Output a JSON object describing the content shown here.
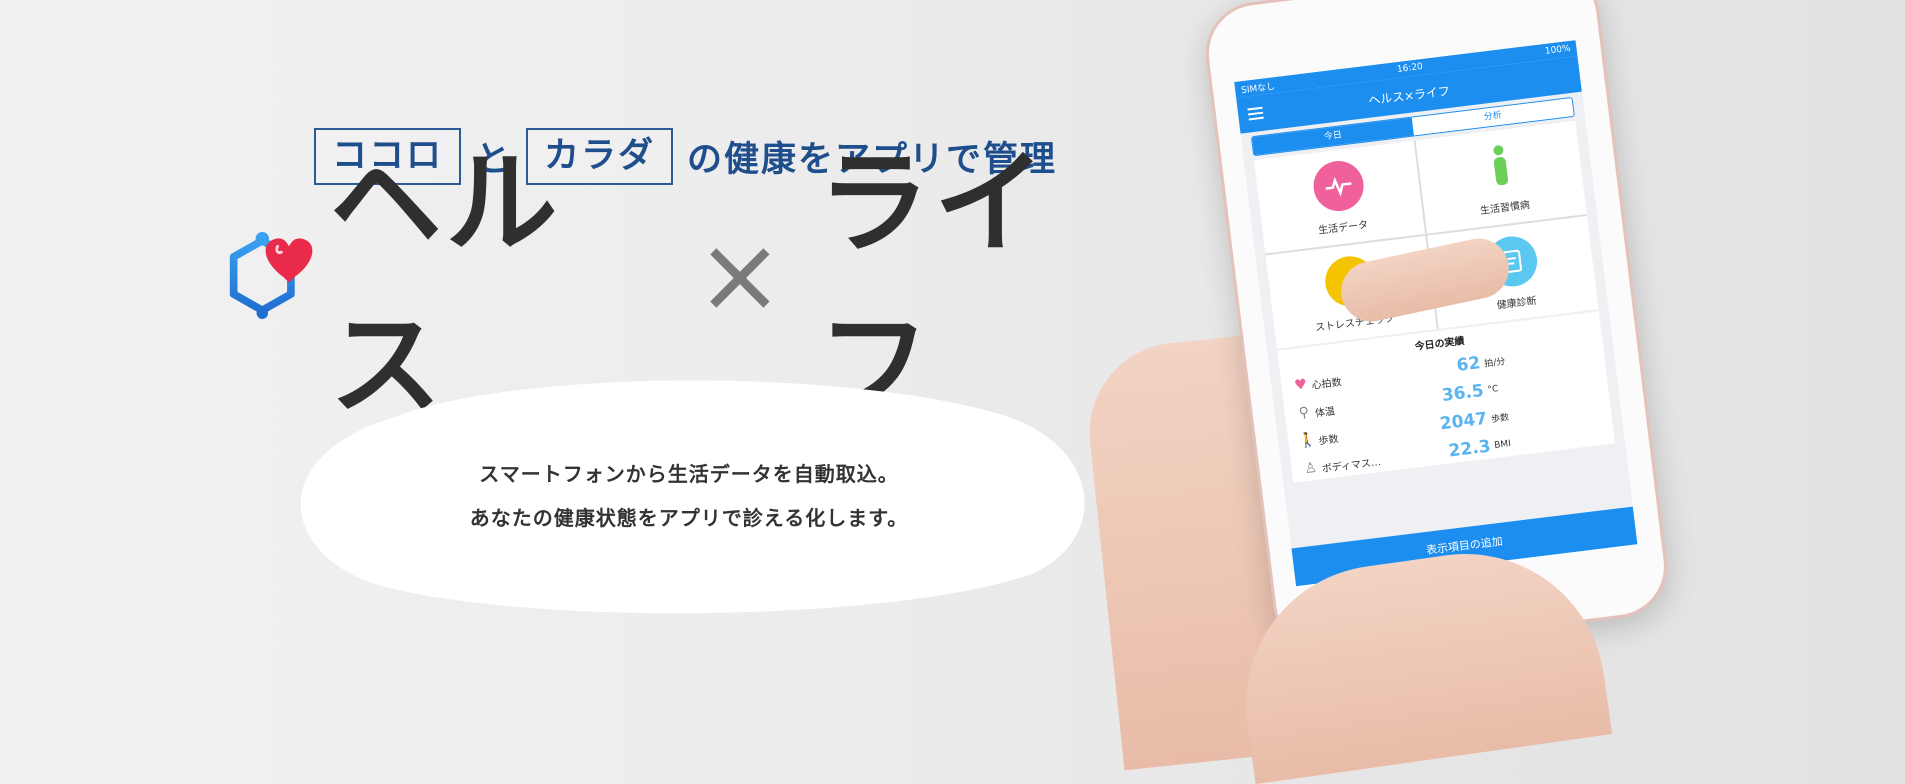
{
  "tagline": {
    "box1": "ココロ",
    "mid": "と",
    "box2": "カラダ",
    "rest": "の健康をアプリで管理"
  },
  "brand": {
    "name_left": "ヘルス",
    "x": "×",
    "name_right": "ライフ"
  },
  "description": {
    "line1": "スマートフォンから生活データを自動取込。",
    "line2": "あなたの健康状態をアプリで診える化します。"
  },
  "phone": {
    "status": {
      "carrier": "SIMなし",
      "time": "16:20",
      "battery": "100%"
    },
    "title": "ヘルス×ライフ",
    "segments": {
      "today": "今日",
      "analysis": "分析"
    },
    "tiles": [
      {
        "label": "生活データ",
        "icon": "heart-pulse-icon",
        "color": "#f0609a"
      },
      {
        "label": "生活習慣病",
        "icon": "body-icon",
        "color": "#6ccf5a"
      },
      {
        "label": "ストレスチェック",
        "icon": "stress-head-icon",
        "color": "#f5c400"
      },
      {
        "label": "健康診断",
        "icon": "clipboard-icon",
        "color": "#5ac8f0"
      }
    ],
    "results_title": "今日の実績",
    "results": [
      {
        "icon": "heart-icon",
        "label": "心拍数",
        "value": "62",
        "unit": "拍/分"
      },
      {
        "icon": "thermometer-icon",
        "label": "体温",
        "value": "36.5",
        "unit": "°C"
      },
      {
        "icon": "walk-icon",
        "label": "歩数",
        "value": "2047",
        "unit": "歩数"
      },
      {
        "icon": "body-mass-icon",
        "label": "ボディマス…",
        "value": "22.3",
        "unit": "BMI"
      }
    ],
    "add_button": "表示項目の追加"
  }
}
